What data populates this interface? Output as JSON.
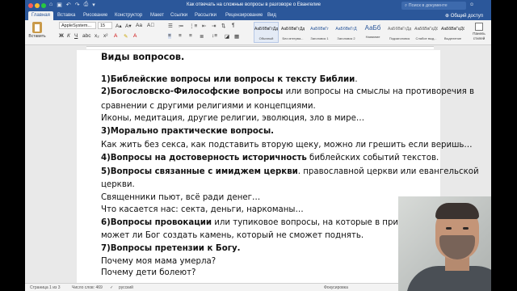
{
  "window": {
    "title": "Как отвечать на сложные вопросы в разговоре о Евангелие",
    "search_placeholder": "Поиск в документе",
    "user_icon": "user-icon"
  },
  "tabs": [
    {
      "label": "Главная",
      "active": true
    },
    {
      "label": "Вставка"
    },
    {
      "label": "Рисование"
    },
    {
      "label": "Конструктор"
    },
    {
      "label": "Макет"
    },
    {
      "label": "Ссылки"
    },
    {
      "label": "Рассылки"
    },
    {
      "label": "Рецензирование"
    },
    {
      "label": "Вид"
    }
  ],
  "share_label": "Общий доступ",
  "ribbon": {
    "paste_label": "Вставить",
    "font_name": "AppleSystem...",
    "font_size": "15",
    "styles": [
      {
        "sample": "АаБбВвГгДд",
        "name": "Обычный"
      },
      {
        "sample": "АаБбВвГгДд",
        "name": "Без интерва..."
      },
      {
        "sample": "АаБбВвГг",
        "name": "Заголовок 1"
      },
      {
        "sample": "АаБбВвГгД",
        "name": "Заголовок 2"
      },
      {
        "sample": "АаБб",
        "name": "Название"
      },
      {
        "sample": "АаБбВвГгДд",
        "name": "Подзаголовок"
      },
      {
        "sample": "АаБбВвГгДд",
        "name": "Слабое выд..."
      },
      {
        "sample": "АаБбВвГгДд",
        "name": "Выделение"
      }
    ],
    "styles_pane_label": "Панель стилей"
  },
  "document": {
    "heading": "Виды вопросов.",
    "lines": [
      {
        "bold": "1)Библейские вопросы или вопросы к тексту Библии",
        "rest": "."
      },
      {
        "bold": "2)Богословско-Философские вопросы",
        "rest": " или вопросы на смыслы на противоречия в"
      },
      {
        "bold": "",
        "rest": "сравнении с другими религиями и концепциями."
      },
      {
        "bold": "",
        "rest": "Иконы, медитация, другие религии, эволюция, зло в мире…"
      },
      {
        "bold": "3)Морально практические вопросы.",
        "rest": ""
      },
      {
        "bold": "",
        "rest": "Как жить без секса, как подставить вторую щеку, можно ли грешить если веришь…"
      },
      {
        "bold": "4)Вопросы на достоверность историчность",
        "rest": " библейских событий текстов."
      },
      {
        "bold": "5)Вопросы связанные с имиджем церкви",
        "rest": ". православной церкви или евангельской"
      },
      {
        "bold": "",
        "rest": "церкви."
      },
      {
        "bold": "",
        "rest": "Священники пьют, всё ради денег…"
      },
      {
        "bold": "",
        "rest": "Что касается нас: секта, деньги, наркоманы…"
      },
      {
        "bold": "6)Вопросы провокации",
        "rest": " или тупиковое вопросы, на которые в принци"
      },
      {
        "bold": "",
        "rest": "может ли Бог создать камень, который не сможет поднять."
      },
      {
        "bold": "7)Вопросы претензии к Богу.",
        "rest": ""
      },
      {
        "bold": "",
        "rest": "Почему моя мама умерла?"
      },
      {
        "bold": "",
        "rest": "Почему дети болеют?"
      }
    ]
  },
  "status": {
    "page": "Страница 1 из 3",
    "words": "Число слов: 469",
    "language": "русский",
    "focus": "Фокусировка"
  },
  "colors": {
    "accent": "#2b579a"
  }
}
